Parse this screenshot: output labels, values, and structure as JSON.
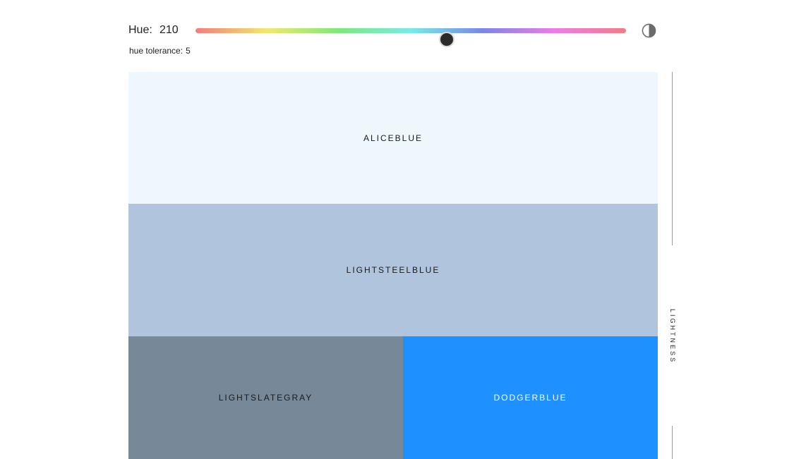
{
  "controls": {
    "hue_label": "Hue:",
    "hue_value": "210",
    "hue_max": 360,
    "tolerance_label": "hue tolerance:",
    "tolerance_value": "5",
    "contrast_icon": "contrast-icon"
  },
  "swatches": [
    {
      "name": "ALICEBLUE",
      "color": "#eff7fe",
      "text_color": "#1a1a1a"
    },
    {
      "name": "LIGHTSTEELBLUE",
      "color": "#b0c4de",
      "text_color": "#1a1a1a"
    },
    {
      "name": "LIGHTSLATEGRAY",
      "color": "#778899",
      "text_color": "#1a1a1a"
    },
    {
      "name": "DODGERBLUE",
      "color": "#1e90ff",
      "text_color": "#ffffff"
    }
  ],
  "axis": {
    "label": "LIGHTNESS"
  }
}
